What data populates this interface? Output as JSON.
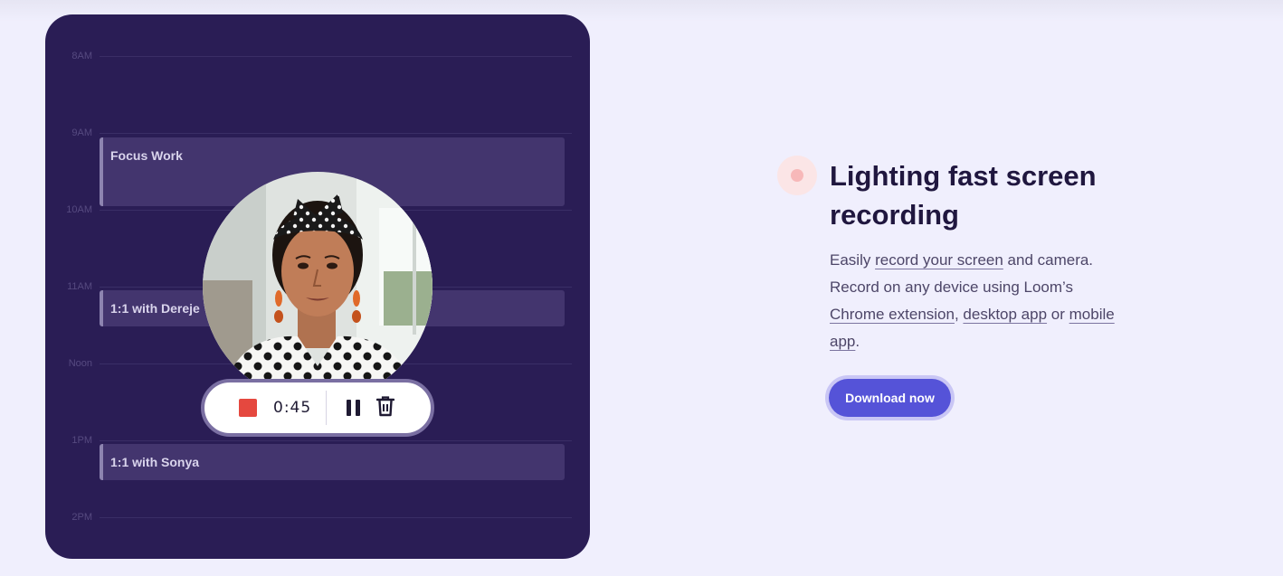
{
  "calendar": {
    "hours": [
      "8AM",
      "9AM",
      "10AM",
      "11AM",
      "Noon",
      "1PM",
      "2PM"
    ],
    "events": [
      {
        "title": "Focus Work"
      },
      {
        "title": "1:1 with Dereje"
      },
      {
        "title": "1:1 with Sonya"
      }
    ]
  },
  "recorder": {
    "timer": "0:45",
    "icons": {
      "stop": "stop-square-icon",
      "pause": "pause-icon",
      "delete": "trash-icon"
    },
    "colors": {
      "stop": "#e5483f"
    }
  },
  "feature": {
    "title": "Lighting fast screen recording",
    "desc_1": "Easily ",
    "link_record": "record your screen",
    "desc_2": " and camera. Record on any device using Loom’s ",
    "link_chrome": "Chrome extension",
    "desc_3": ", ",
    "link_desktop": "desktop app",
    "desc_4": " or ",
    "link_mobile": "mobile app",
    "desc_5": ".",
    "cta_label": "Download now"
  },
  "colors": {
    "accent": "#5553d8",
    "calendar_bg": "#2a1d55",
    "page_bg": "#f0effd"
  }
}
